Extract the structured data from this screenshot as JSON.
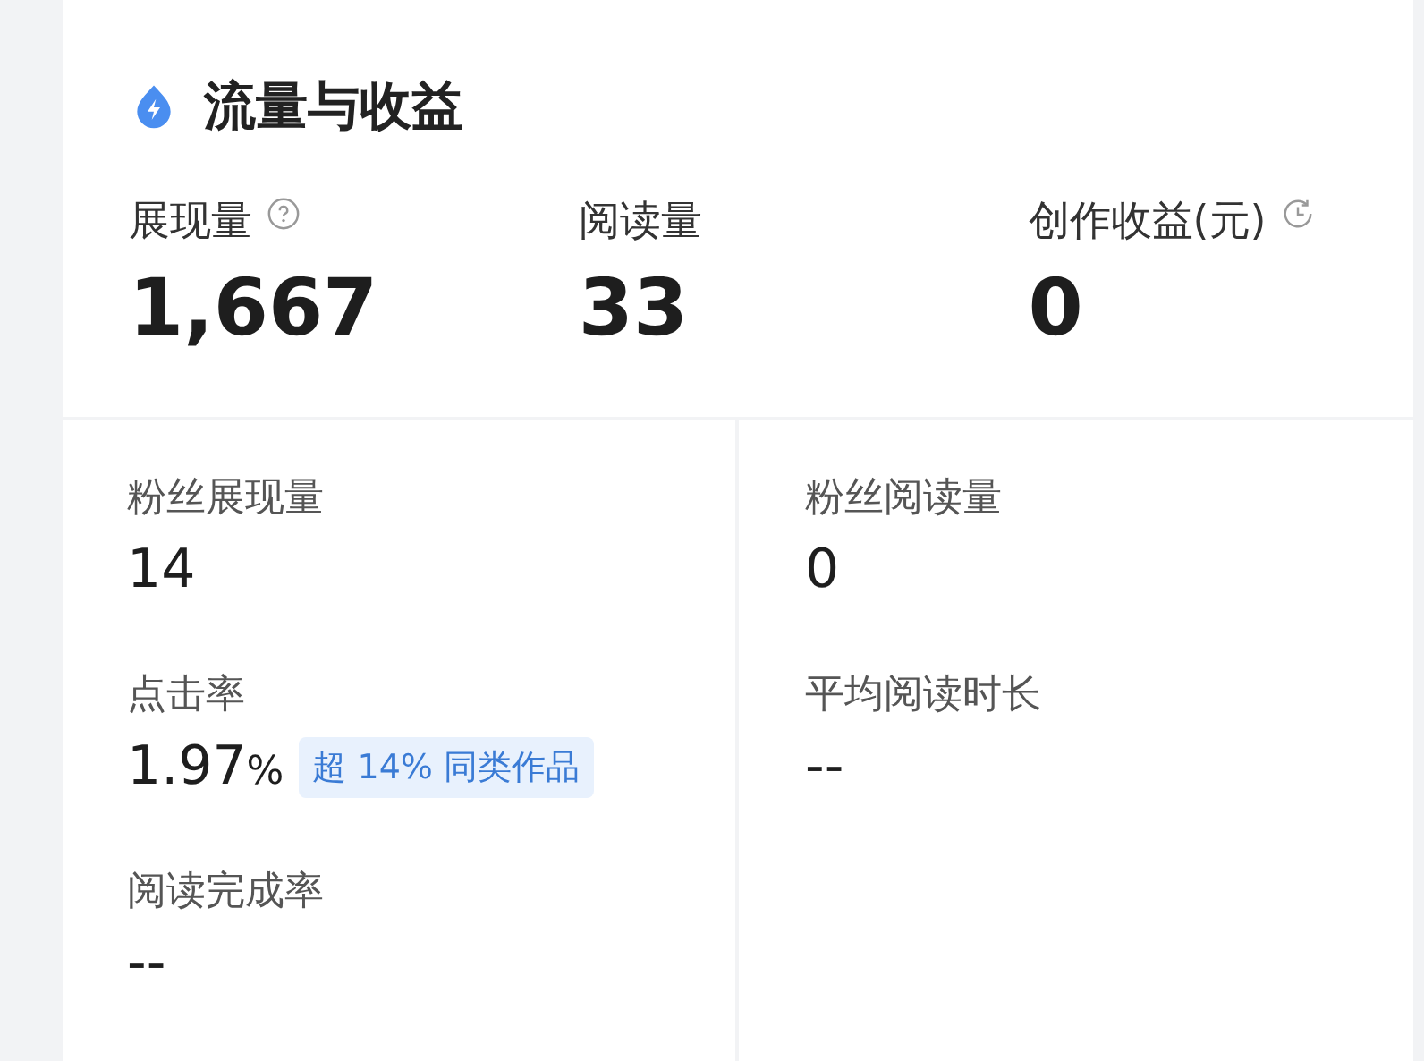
{
  "header": {
    "title": "流量与收益"
  },
  "main_metrics": [
    {
      "kind": "help",
      "label": "展现量",
      "value": "1,667"
    },
    {
      "kind": "plain",
      "label": "阅读量",
      "value": "33"
    },
    {
      "kind": "refresh",
      "label": "创作收益(元)",
      "value": "0"
    }
  ],
  "detail_columns": [
    {
      "metrics": [
        {
          "label": "粉丝展现量",
          "value": "14"
        },
        {
          "label": "点击率",
          "value": "1.97",
          "unit": "%",
          "badge": "超 14% 同类作品"
        },
        {
          "label": "阅读完成率",
          "value": "--"
        }
      ]
    },
    {
      "metrics": [
        {
          "label": "粉丝阅读量",
          "value": "0"
        },
        {
          "label": "平均阅读时长",
          "value": "--"
        }
      ]
    }
  ]
}
